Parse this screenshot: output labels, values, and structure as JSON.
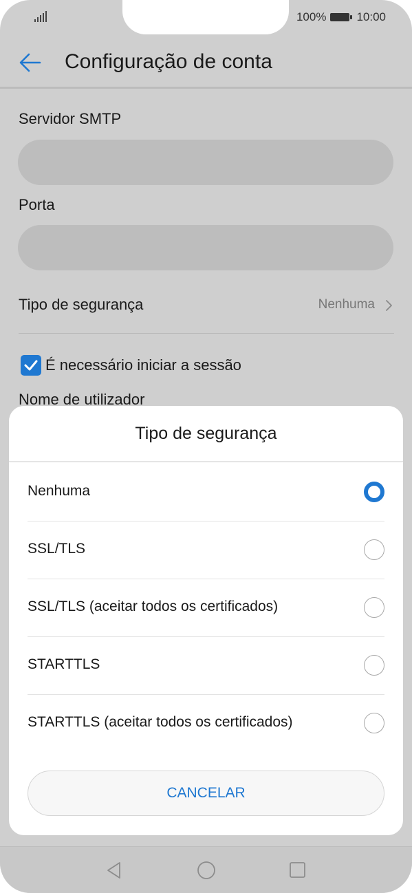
{
  "status_bar": {
    "battery_percent": "100%",
    "time": "10:00",
    "icons": [
      "signal-icon",
      "battery-icon"
    ]
  },
  "app_bar": {
    "back_icon": "arrow-left-icon",
    "title": "Configuração de conta"
  },
  "form": {
    "smtp_label": "Servidor SMTP",
    "smtp_value": "",
    "port_label": "Porta",
    "port_value": "",
    "security_label": "Tipo de segurança",
    "security_value": "Nenhuma",
    "login_required_label": "É necessário iniciar a sessão",
    "login_required_checked": true,
    "username_label": "Nome de utilizador"
  },
  "dialog": {
    "title": "Tipo de segurança",
    "options": [
      {
        "label": "Nenhuma",
        "selected": true
      },
      {
        "label": "SSL/TLS",
        "selected": false
      },
      {
        "label": "SSL/TLS (aceitar todos os certificados)",
        "selected": false
      },
      {
        "label": "STARTTLS",
        "selected": false
      },
      {
        "label": "STARTTLS (aceitar todos os certificados)",
        "selected": false
      }
    ],
    "cancel_label": "CANCELAR"
  },
  "nav_bar": {
    "icons": [
      "nav-back-icon",
      "nav-home-icon",
      "nav-recents-icon"
    ]
  },
  "colors": {
    "accent": "#1f78d1",
    "scrim_background": "#cfcfcf",
    "dialog_background": "#ffffff"
  }
}
